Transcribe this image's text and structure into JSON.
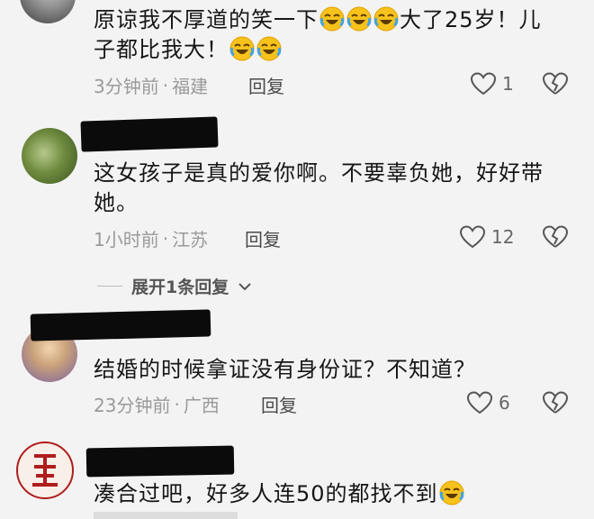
{
  "comments": [
    {
      "text_line1": "原谅我不厚道的笑一下",
      "text_line1_tail": "大了25岁！儿",
      "text_line2": "子都比我大！",
      "time": "3分钟前",
      "location": "福建",
      "reply_label": "回复",
      "likes": "1"
    },
    {
      "text": "这女孩子是真的爱你啊。不要辜负她，好好带她。",
      "time": "1小时前",
      "location": "江苏",
      "reply_label": "回复",
      "likes": "12"
    },
    {
      "text": "结婚的时候拿证没有身份证？不知道？",
      "time": "23分钟前",
      "location": "广西",
      "reply_label": "回复",
      "likes": "6"
    },
    {
      "text": "凑合过吧，好多人连50的都找不到"
    }
  ],
  "expand_replies": "展开1条回复",
  "separator": "·",
  "icons": {
    "emoji": "laughing-tears-icon",
    "like": "heart-icon",
    "dislike": "broken-heart-icon",
    "chevron": "chevron-down-icon"
  },
  "colors": {
    "background": "#f3f3f3",
    "meta": "#9a9a9a",
    "emoji": "#f5b91a"
  }
}
